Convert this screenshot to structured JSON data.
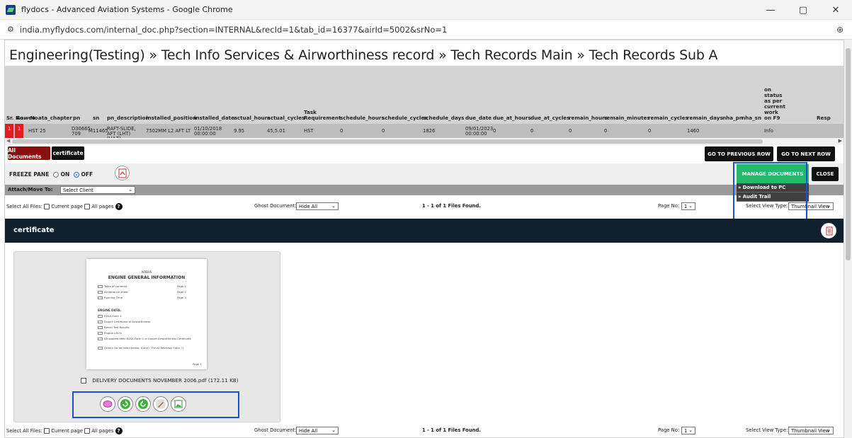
{
  "browser": {
    "title": "flydocs - Advanced Aviation Systems - Google Chrome",
    "url": "india.myflydocs.com/internal_doc.php?section=INTERNAL&recId=1&tab_id=16377&airId=5002&srNo=1",
    "controls": {
      "minimize": "—",
      "maximize": "▢",
      "close": "✕"
    }
  },
  "breadcrumb": "Engineering(Testing) » Tech Info Services & Airworthiness record » Tech Records Main » Tech Records Sub A",
  "table": {
    "headers": [
      "Sr. No.",
      "Row No.",
      "eo",
      "ata_chapter",
      "pn",
      "sn",
      "pn_description",
      "installed_position",
      "installed_date",
      "actual_hours",
      "actual_cycles",
      "Task Requirement",
      "schedule_hours",
      "schedule_cycles",
      "schedule_days",
      "due_date",
      "due_at_hours",
      "due_at_cycles",
      "remain_hours",
      "remain_minutes",
      "remain_cycles",
      "remain_days",
      "nha_pn",
      "nha_sn",
      "on status as per current work on F9",
      "Resp"
    ],
    "row": [
      "1",
      "1",
      "HST",
      "25",
      "D30665-709",
      "M11465",
      "RAFT-SLIDE, AFT (LHT) (HAZ)",
      "7502MM L2 AFT LT",
      "01/10/2018 00:00:00",
      "9.95",
      "45,5.01",
      "HST",
      "0",
      "0",
      "1826",
      "09/01/2023 00:00:00",
      "0",
      "0",
      "0",
      "0",
      "0",
      "1460",
      "",
      "",
      "Info",
      ""
    ]
  },
  "tabs": {
    "all_documents": "All Documents",
    "certificate": "certificate"
  },
  "nav": {
    "prev": "GO TO PREVIOUS ROW",
    "next": "GO TO NEXT ROW"
  },
  "freeze": {
    "label": "FREEZE PANE",
    "on": "ON",
    "off": "OFF",
    "selected": "OFF"
  },
  "manage": {
    "label": "MANAGE DOCUMENTS",
    "close": "CLOSE",
    "menu": [
      "» Download to PC",
      "» Audit Trail"
    ]
  },
  "attach": {
    "label": "Attach/Move To:",
    "value": "Select Client"
  },
  "files_bar": {
    "select_all": "Select All Files:",
    "current_page": "Current page",
    "all_pages": "All pages",
    "ghost_label": "Ghost Document:",
    "ghost_value": "Hide All",
    "found": "1 - 1 of 1 Files Found.",
    "page_label": "Page No:",
    "page_value": "1",
    "view_label": "Select View Type:",
    "view_value": "Thumbnail View"
  },
  "section_title": "certificate",
  "document": {
    "filename": "DELIVERY DOCUMENTS NOVEMBER 2006.pdf",
    "size": "(172.11 KB)",
    "preview": {
      "brand": "AIRBUS",
      "heading": "ENGINE GENERAL INFORMATION",
      "toc": [
        [
          "Table of contents",
          "Page 1"
        ],
        [
          "Acceptance sheet",
          "Page 2"
        ],
        [
          "Running Time",
          "Page 3"
        ]
      ],
      "data_heading": "ENGINE DATA:",
      "data_items": [
        "EASA Form 1",
        "Export Certificate of Airworthiness",
        "Bench Test Results",
        "Engine LRU's",
        "SB applied after EASA Form 1 or Export Airworthiness Certificate",
        "Others (to be listed below, if any): Thrust Reverser Fotor / J"
      ],
      "footer": "Page 1"
    }
  },
  "colors": {
    "accent_red": "#8b0e0e",
    "manage_green": "#24b86a",
    "highlight_blue": "#1b4fd8",
    "header_navy": "#10202f"
  }
}
